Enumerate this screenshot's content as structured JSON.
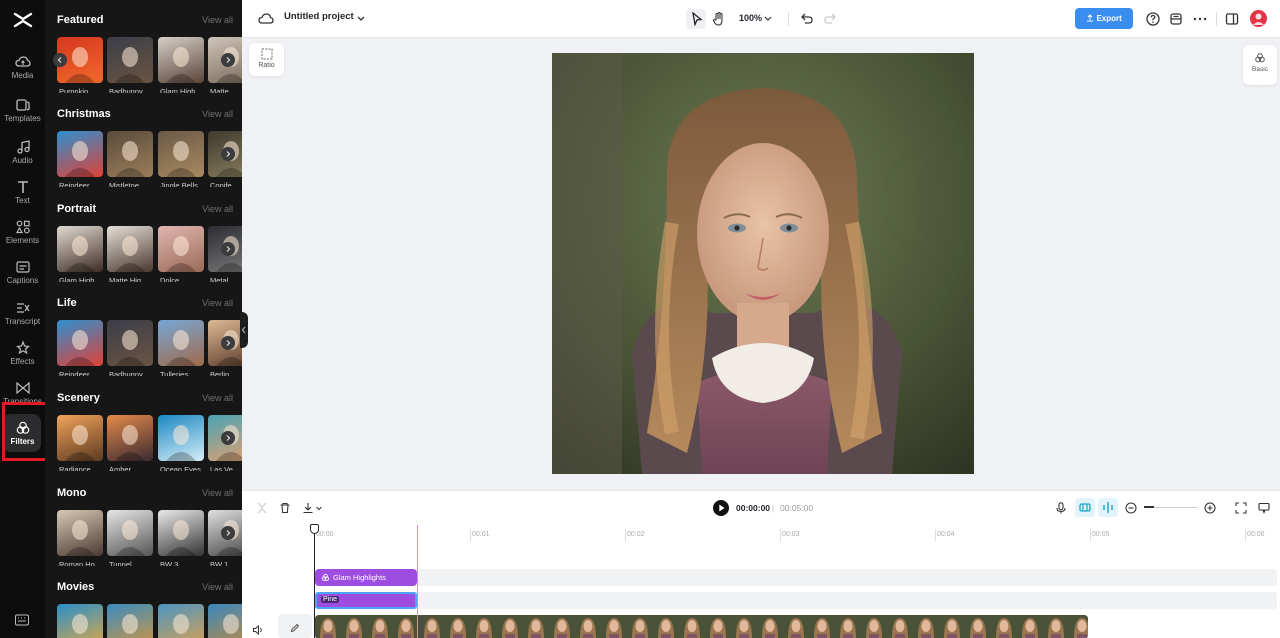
{
  "rail": {
    "items": [
      {
        "label": "Media",
        "icon": "cloud-icon"
      },
      {
        "label": "Templates",
        "icon": "templates-icon"
      },
      {
        "label": "Audio",
        "icon": "music-note-icon"
      },
      {
        "label": "Text",
        "icon": "text-icon"
      },
      {
        "label": "Elements",
        "icon": "elements-icon"
      },
      {
        "label": "Captions",
        "icon": "captions-icon"
      },
      {
        "label": "Transcript",
        "icon": "transcript-icon"
      },
      {
        "label": "Effects",
        "icon": "effects-icon"
      },
      {
        "label": "Transitions",
        "icon": "transitions-icon"
      },
      {
        "label": "Filters",
        "icon": "filters-icon",
        "active": true
      }
    ]
  },
  "panel": {
    "view_all": "View all",
    "sections": [
      {
        "title": "Featured",
        "items": [
          "Pumpkin",
          "Badbunny",
          "Glam High…",
          "Matte"
        ]
      },
      {
        "title": "Christmas",
        "items": [
          "Reindeer",
          "Mistletoe",
          "Jingle Bells",
          "Conife"
        ]
      },
      {
        "title": "Portrait",
        "items": [
          "Glam High…",
          "Matte Hig…",
          "Dolce",
          "Metal"
        ]
      },
      {
        "title": "Life",
        "items": [
          "Reindeer",
          "Badbunny",
          "Tulleries",
          "Berlin"
        ]
      },
      {
        "title": "Scenery",
        "items": [
          "Radiance",
          "Amber",
          "Ocean Eyes",
          "Las Ve"
        ]
      },
      {
        "title": "Mono",
        "items": [
          "Roman Ho…",
          "Tunnel",
          "BW 3",
          "BW 1"
        ]
      },
      {
        "title": "Movies",
        "items": []
      }
    ]
  },
  "topbar": {
    "project_name": "Untitled project",
    "zoom": "100%",
    "export_label": "Export"
  },
  "canvas": {
    "ratio_label": "Ratio",
    "basic_label": "Basic"
  },
  "timeline": {
    "current_time": "00:00:00",
    "separator": "|",
    "total_time": "00:05:00",
    "ruler": [
      "00:00",
      "00:01",
      "00:02",
      "00:03",
      "00:04",
      "00:05",
      "00:06"
    ],
    "filter_clip": "Glam Highlights",
    "pine_clip": "Pine"
  },
  "colors": {
    "accent": "#3a8ef0",
    "clip_purple": "#9d4ee0",
    "highlight_red": "#e01b24"
  }
}
